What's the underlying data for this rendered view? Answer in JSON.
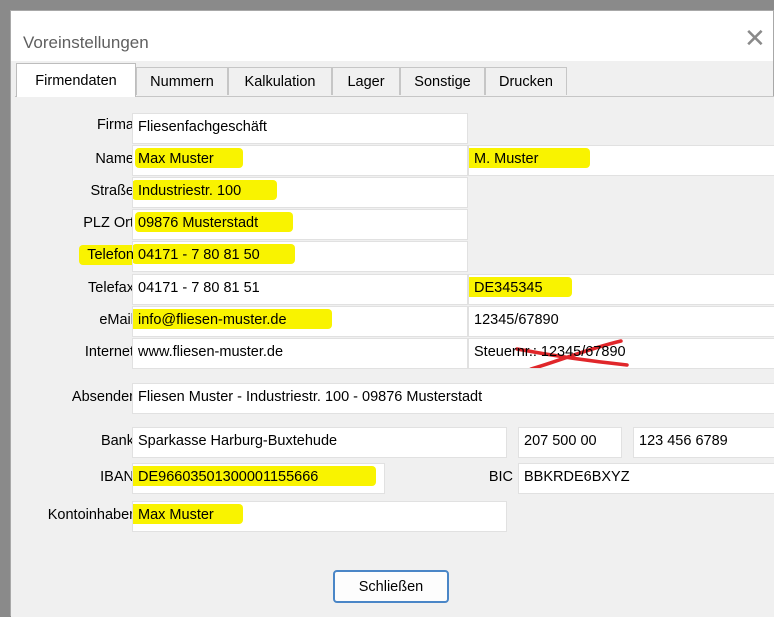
{
  "window": {
    "title": "Voreinstellungen"
  },
  "tabs": [
    "Firmendaten",
    "Nummern",
    "Kalkulation",
    "Lager",
    "Sonstige",
    "Drucken"
  ],
  "form": {
    "firma": {
      "label": "Firma",
      "value": "Fliesenfachgeschäft"
    },
    "name": {
      "label": "Name",
      "value": "Max Muster",
      "value2": "M. Muster"
    },
    "strasse": {
      "label": "Straße",
      "value": "Industriestr. 100"
    },
    "plz_ort": {
      "label": "PLZ Ort",
      "value": "09876 Musterstadt"
    },
    "telefon": {
      "label": "Telefon",
      "value": "04171 - 7 80 81 50"
    },
    "telefax": {
      "label": "Telefax",
      "value": "04171 - 7 80 81 51",
      "value2": "DE345345"
    },
    "email": {
      "label": "eMail",
      "value": "info@fliesen-muster.de",
      "value2": "12345/67890"
    },
    "internet": {
      "label": "Internet",
      "value": "www.fliesen-muster.de",
      "value2": "Steuernr.: 12345/67890"
    },
    "absender": {
      "label": "Absender",
      "value": "Fliesen Muster - Industriestr. 100 - 09876 Musterstadt"
    },
    "bank": {
      "label": "Bank",
      "value": "Sparkasse Harburg-Buxtehude",
      "blz": "207 500 00",
      "konto": "123 456 6789"
    },
    "iban": {
      "label": "IBAN",
      "value": "DE96603501300001155666"
    },
    "bic": {
      "label": "BIC",
      "value": "BBKRDE6BXYZ"
    },
    "kontoinhaber": {
      "label": "Kontoinhaber",
      "value": "Max Muster"
    }
  },
  "footer": {
    "close_button": "Schließen"
  },
  "colors": {
    "highlight": "#f9f300",
    "strike": "#e0262a",
    "button_border": "#4a86c7"
  }
}
